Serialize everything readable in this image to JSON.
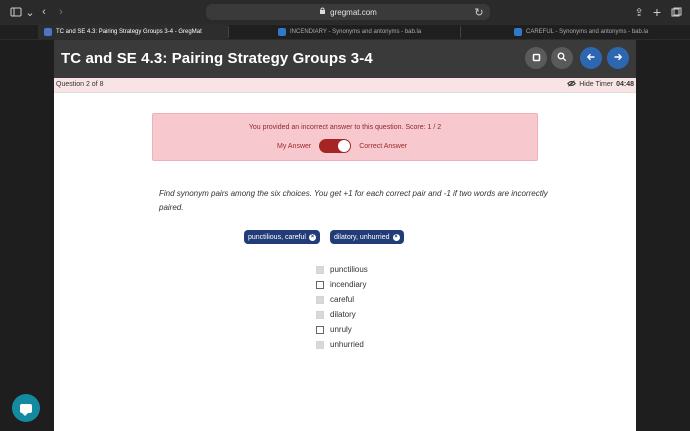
{
  "browser": {
    "url": "gregmat.com",
    "icons": {
      "sidebar": "sidebar-icon",
      "back": "chevron-left-icon",
      "forward": "chevron-right-icon",
      "lock": "lock-icon",
      "reload": "reload-icon",
      "share": "share-icon",
      "new_tab": "plus-icon",
      "tabs_overview": "tabs-icon"
    },
    "tabs": [
      {
        "label": "TC and SE 4.3: Pairing Strategy Groups 3-4 - GregMat"
      },
      {
        "label": "INCENDIARY - Synonyms and antonyms - bab.la"
      },
      {
        "label": "CAREFUL - Synonyms and antonyms - bab.la"
      }
    ]
  },
  "app": {
    "title": "TC and SE 4.3: Pairing Strategy Groups 3-4",
    "question_count": "Question 2 of 8",
    "timer_label": "Hide Timer",
    "timer_value": "04:48",
    "header_icons": {
      "stop": "stop-icon",
      "search": "search-icon",
      "prev": "arrow-left-icon",
      "next": "arrow-right-icon"
    }
  },
  "result": {
    "message": "You provided an incorrect answer to this question. Score: 1 / 2",
    "my_answer_label": "My Answer",
    "correct_answer_label": "Correct Answer"
  },
  "question": {
    "instruction": "Find synonym pairs among the six choices. You get +1 for each correct pair and -1 if two words are incorrectly paired.",
    "selected_pairs": [
      {
        "label": "punctilious, careful"
      },
      {
        "label": "dilatory, unhurried"
      }
    ],
    "choices": [
      {
        "label": "punctilious",
        "state": "disabled"
      },
      {
        "label": "incendiary",
        "state": "unchecked"
      },
      {
        "label": "careful",
        "state": "disabled"
      },
      {
        "label": "dilatory",
        "state": "disabled"
      },
      {
        "label": "unruly",
        "state": "unchecked"
      },
      {
        "label": "unhurried",
        "state": "disabled"
      }
    ]
  },
  "colors": {
    "header_bg": "#3a3a3a",
    "result_bg": "#f7c9cf",
    "error_text": "#8d2727",
    "toggle_red": "#a52525",
    "pair_blue": "#213c78",
    "nav_blue": "#2e67b1",
    "chat_teal": "#148aa0"
  }
}
